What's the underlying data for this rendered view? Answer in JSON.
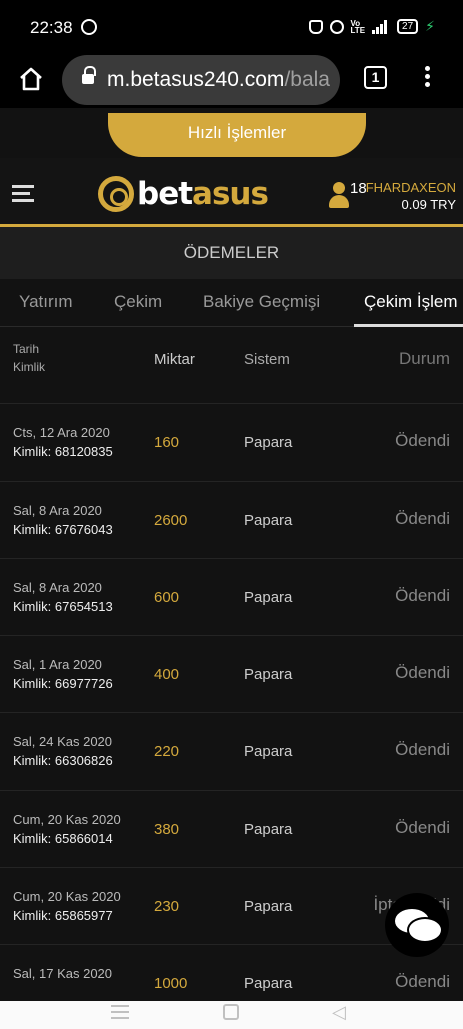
{
  "status": {
    "time": "22:38",
    "battery": "27"
  },
  "browser": {
    "url_main": "m.betasus240.com",
    "url_rest": "/bala",
    "tab_count": "1"
  },
  "header": {
    "quick_actions": "Hızlı İşlemler",
    "logo_main": "bet",
    "logo_accent": "asus",
    "user_count": "18",
    "username": "FHARDAXEON",
    "balance": "0.09 TRY"
  },
  "section_title": "ÖDEMELER",
  "tabs": [
    {
      "label": "Yatırım"
    },
    {
      "label": "Çekim"
    },
    {
      "label": "Bakiye Geçmişi"
    },
    {
      "label": "Çekim İşlem"
    }
  ],
  "table": {
    "headers": {
      "date": "Tarih",
      "id": "Kimlik",
      "amount": "Miktar",
      "system": "Sistem",
      "status": "Durum"
    },
    "rows": [
      {
        "date": "Cts, 12 Ara 2020",
        "id": "Kimlik: 68120835",
        "amount": "160",
        "system": "Papara",
        "status": "Ödendi"
      },
      {
        "date": "Sal, 8 Ara 2020",
        "id": "Kimlik: 67676043",
        "amount": "2600",
        "system": "Papara",
        "status": "Ödendi"
      },
      {
        "date": "Sal, 8 Ara 2020",
        "id": "Kimlik: 67654513",
        "amount": "600",
        "system": "Papara",
        "status": "Ödendi"
      },
      {
        "date": "Sal, 1 Ara 2020",
        "id": "Kimlik: 66977726",
        "amount": "400",
        "system": "Papara",
        "status": "Ödendi"
      },
      {
        "date": "Sal, 24 Kas 2020",
        "id": "Kimlik: 66306826",
        "amount": "220",
        "system": "Papara",
        "status": "Ödendi"
      },
      {
        "date": "Cum, 20 Kas 2020",
        "id": "Kimlik: 65866014",
        "amount": "380",
        "system": "Papara",
        "status": "Ödendi"
      },
      {
        "date": "Cum, 20 Kas 2020",
        "id": "Kimlik: 65865977",
        "amount": "230",
        "system": "Papara",
        "status": "İptal edildi"
      },
      {
        "date": "Sal, 17 Kas 2020",
        "id": "",
        "amount": "1000",
        "system": "Papara",
        "status": "Ödendi"
      }
    ]
  }
}
